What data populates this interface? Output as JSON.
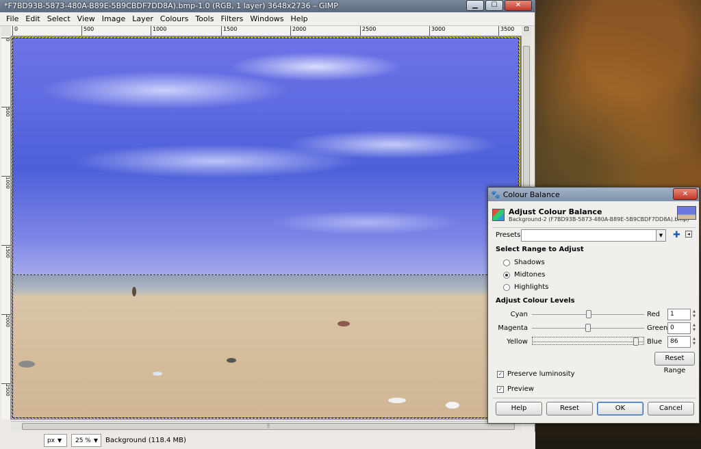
{
  "window": {
    "title": "*F7BD93B-5873-480A-B89E-5B9CBDF7DD8A).bmp-1.0 (RGB, 1 layer) 3648x2736 – GIMP",
    "minimize": "▁",
    "maximize": "☐",
    "close": "✕"
  },
  "menu": [
    "File",
    "Edit",
    "Select",
    "View",
    "Image",
    "Layer",
    "Colours",
    "Tools",
    "Filters",
    "Windows",
    "Help"
  ],
  "ruler": {
    "h_ticks": [
      "0",
      "500",
      "1000",
      "1500",
      "2000",
      "2500",
      "3000",
      "3500"
    ],
    "v_ticks": [
      "0",
      "500",
      "1000",
      "1500",
      "2000",
      "2500"
    ]
  },
  "status": {
    "unit": "px",
    "zoom": "25 %",
    "info": "Background (118.4 MB)"
  },
  "dialog": {
    "title": "Colour Balance",
    "heading": "Adjust Colour Balance",
    "subheading": "Background-2 (F7BD93B-5873-480A-B89E-5B9CBDF7DD8A).bmp)",
    "presets_label": "Presets:",
    "presets_value": "",
    "range_heading": "Select Range to Adjust",
    "ranges": [
      {
        "label": "Shadows",
        "selected": false
      },
      {
        "label": "Midtones",
        "selected": true
      },
      {
        "label": "Highlights",
        "selected": false
      }
    ],
    "levels_heading": "Adjust Colour Levels",
    "sliders": [
      {
        "left": "Cyan",
        "right": "Red",
        "value": "1",
        "pos": 0.505
      },
      {
        "left": "Magenta",
        "right": "Green",
        "value": "0",
        "pos": 0.5
      },
      {
        "left": "Yellow",
        "right": "Blue",
        "value": "86",
        "pos": 0.93
      }
    ],
    "reset_range": "Reset Range",
    "preserve_luminosity": "Preserve luminosity",
    "preview": "Preview",
    "buttons": {
      "help": "Help",
      "reset": "Reset",
      "ok": "OK",
      "cancel": "Cancel"
    }
  }
}
